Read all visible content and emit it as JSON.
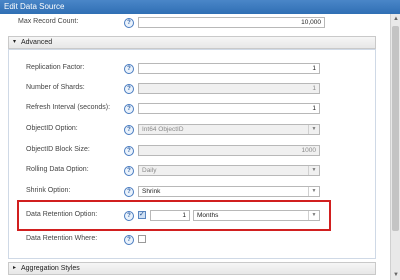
{
  "window": {
    "title": "Edit Data Source"
  },
  "max_record": {
    "label": "Max Record Count:",
    "value": "10,000"
  },
  "advanced": {
    "header": "Advanced",
    "replication_factor": {
      "label": "Replication Factor:",
      "value": "1"
    },
    "number_of_shards": {
      "label": "Number of Shards:",
      "value": "1"
    },
    "refresh_interval": {
      "label": "Refresh Interval (seconds):",
      "value": "1"
    },
    "objectid_option": {
      "label": "ObjectID Option:",
      "value": "Int64 ObjectID"
    },
    "objectid_block_size": {
      "label": "ObjectID Block Size:",
      "value": "1000"
    },
    "rolling_data_option": {
      "label": "Rolling Data Option:",
      "value": "Daily"
    },
    "shrink_option": {
      "label": "Shrink Option:",
      "value": "Shrink"
    },
    "data_retention_option": {
      "label": "Data Retention Option:",
      "enabled": true,
      "value": "1",
      "unit": "Months"
    },
    "data_retention_where": {
      "label": "Data Retention Where:",
      "checked": false
    }
  },
  "aggregation": {
    "header": "Aggregation Styles"
  },
  "help_glyph": "?",
  "arrow_glyph": "▼",
  "expanded_glyph": "▾",
  "collapsed_glyph": "▸",
  "scroll_up_glyph": "▲",
  "scroll_down_glyph": "▼"
}
